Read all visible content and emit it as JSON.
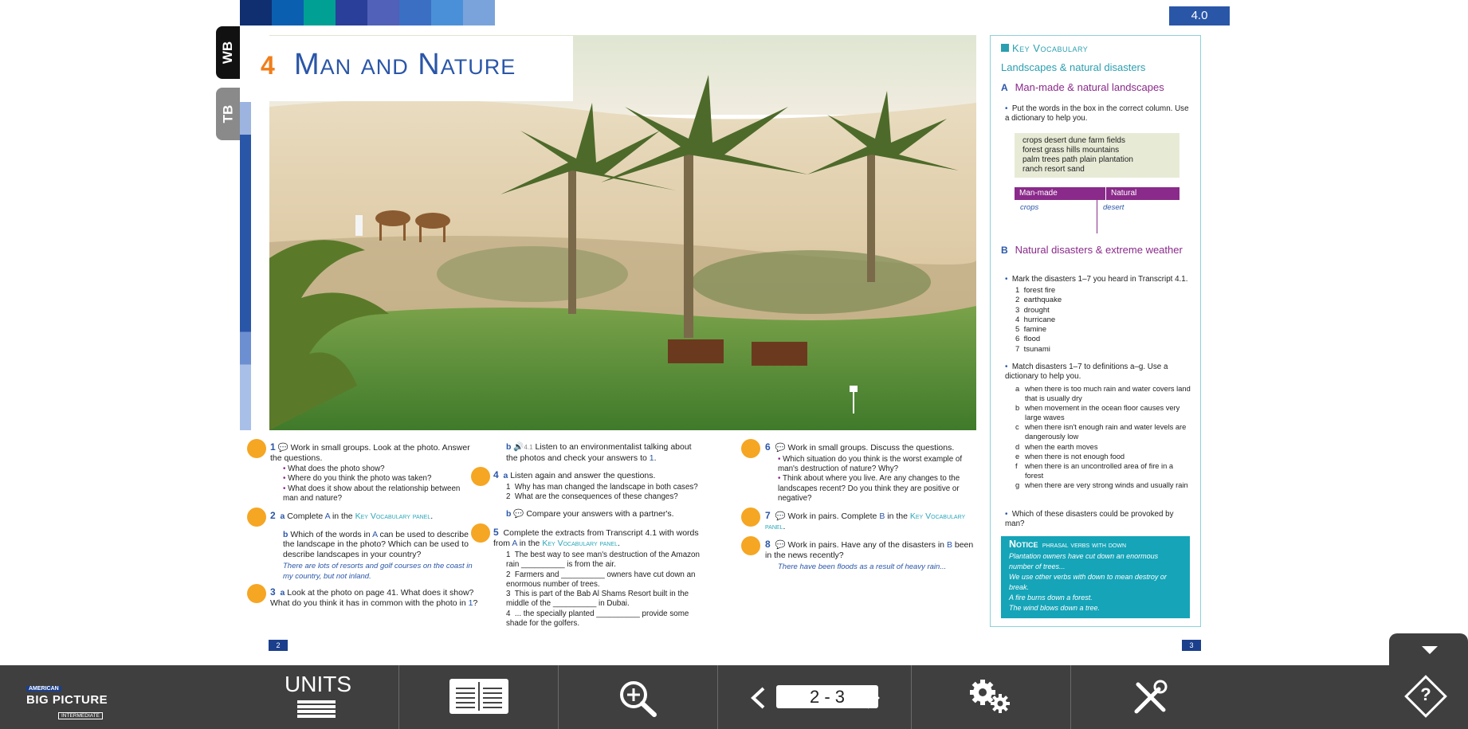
{
  "page": {
    "unit_badge": "4.0",
    "tab_wb": "WB",
    "tab_tb": "TB",
    "strip_colors": [
      "#0f2f70",
      "#0b5fb0",
      "#00a095",
      "#2a3f9a",
      "#5160b8",
      "#3a6fc4",
      "#4a90d8",
      "#7aa3dc"
    ],
    "unit_number": "4",
    "unit_title": "Man and Nature",
    "page_left": "2",
    "page_right": "3"
  },
  "exercises": {
    "e1": {
      "num": "1",
      "text": "Work in small groups. Look at the photo. Answer the questions.",
      "items": [
        "What does the photo show?",
        "Where do you think the photo was taken?",
        "What does it show about the relationship between man and nature?"
      ]
    },
    "e2a": {
      "num": "2",
      "letter": "a",
      "text": "Complete",
      "ref": "A",
      "mid": "in the",
      "panel": "Key Vocabulary panel",
      "end": "."
    },
    "e2b": {
      "letter": "b",
      "text": "Which of the words in",
      "ref": "A",
      "rest": "can be used to describe the landscape in the photo? Which can be used to describe landscapes in your country?",
      "example": "There are lots of resorts and golf courses on the coast in my country, but not inland."
    },
    "e3a": {
      "num": "3",
      "letter": "a",
      "text": "Look at the photo on page 41. What does it show? What do you think it has in common with the photo in",
      "ref": "1",
      "end": "?"
    },
    "e3b": {
      "letter": "b",
      "audio": "4.1",
      "text": "Listen to an environmentalist talking about the photos and check your answers to",
      "ref": "1",
      "end": "."
    },
    "e4a": {
      "num": "4",
      "letter": "a",
      "text": "Listen again and answer the questions.",
      "items": [
        {
          "n": "1",
          "t": "Why has man changed the landscape in both cases?"
        },
        {
          "n": "2",
          "t": "What are the consequences of these changes?"
        }
      ]
    },
    "e4b": {
      "letter": "b",
      "text": "Compare your answers with a partner's."
    },
    "e5": {
      "num": "5",
      "text": "Complete the extracts from Transcript 4.1 with words from",
      "ref": "A",
      "mid": "in the",
      "panel": "Key Vocabulary panel",
      "end": ".",
      "items": [
        {
          "n": "1",
          "t": "The best way to see man's destruction of the Amazon rain __________ is from the air."
        },
        {
          "n": "2",
          "t": "Farmers and __________ owners have cut down an enormous number of trees."
        },
        {
          "n": "3",
          "t": "This is part of the Bab Al Shams Resort built in the middle of the __________ in Dubai."
        },
        {
          "n": "4",
          "t": "... the specially planted __________ provide some shade for the golfers."
        }
      ]
    },
    "e6": {
      "num": "6",
      "text": "Work in small groups. Discuss the questions.",
      "items": [
        "Which situation do you think is the worst example of man's destruction of nature? Why?",
        "Think about where you live. Are any changes to the landscapes recent? Do you think they are positive or negative?"
      ]
    },
    "e7": {
      "num": "7",
      "text": "Work in pairs. Complete",
      "ref": "B",
      "mid": "in the",
      "panel": "Key Vocabulary panel",
      "end": "."
    },
    "e8": {
      "num": "8",
      "text": "Work in pairs. Have any of the disasters in",
      "ref": "B",
      "rest": "been in the news recently?",
      "example": "There have been floods as a result of heavy rain..."
    }
  },
  "vocab": {
    "heading": "Key Vocabulary",
    "subheading": "Landscapes & natural disasters",
    "secA_letter": "A",
    "secA_title": "Man-made & natural landscapes",
    "secA_instr": "Put the words in the box in the correct column. Use a dictionary to help you.",
    "wordbox": [
      "crops   desert   dune   farm   fields",
      "forest   grass   hills   mountains",
      "palm trees   path   plain   plantation",
      "ranch   resort   sand"
    ],
    "col_manmade": "Man-made",
    "col_natural": "Natural",
    "ex_manmade": "crops",
    "ex_natural": "desert",
    "secB_letter": "B",
    "secB_title": "Natural disasters & extreme weather",
    "secB_instr1": "Mark the disasters 1–7 you heard in Transcript 4.1.",
    "disasters": [
      {
        "n": "1",
        "t": "forest fire"
      },
      {
        "n": "2",
        "t": "earthquake"
      },
      {
        "n": "3",
        "t": "drought"
      },
      {
        "n": "4",
        "t": "hurricane"
      },
      {
        "n": "5",
        "t": "famine"
      },
      {
        "n": "6",
        "t": "flood"
      },
      {
        "n": "7",
        "t": "tsunami"
      }
    ],
    "secB_instr2": "Match disasters 1–7 to definitions a–g. Use a dictionary to help you.",
    "definitions": [
      {
        "l": "a",
        "t": "when there is too much rain and water covers land that is usually dry"
      },
      {
        "l": "b",
        "t": "when movement in the ocean floor causes very large waves"
      },
      {
        "l": "c",
        "t": "when there isn't enough rain and water levels are dangerously low"
      },
      {
        "l": "d",
        "t": "when the earth moves"
      },
      {
        "l": "e",
        "t": "when there is not enough food"
      },
      {
        "l": "f",
        "t": "when there is an uncontrolled area of fire in a forest"
      },
      {
        "l": "g",
        "t": "when there are very strong winds and usually rain"
      }
    ],
    "secB_instr3": "Which of these disasters could be provoked by man?",
    "notice_title": "Notice",
    "notice_sub": "phrasal verbs with down",
    "notice_lines": [
      "Plantation owners have cut down an enormous number of trees...",
      "We use other verbs with down to mean destroy or break.",
      "A fire burns down a forest.",
      "The wind blows down a tree."
    ]
  },
  "toolbar": {
    "logo_top": "AMERICAN",
    "logo_main": "BIG PICTURE",
    "logo_level": "INTERMEDIATE",
    "units_label": "UNITS",
    "page_value": "2 - 3",
    "help_label": "?"
  }
}
